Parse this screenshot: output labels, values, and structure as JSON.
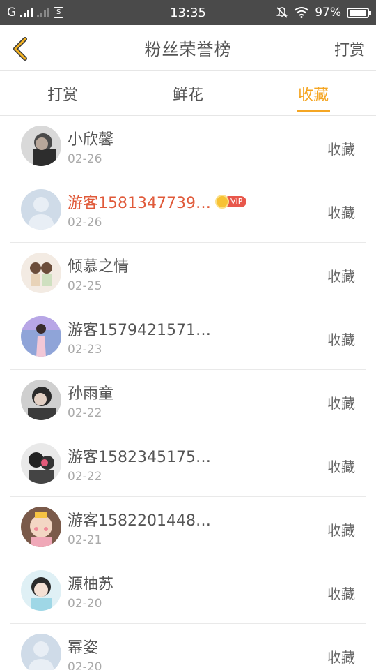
{
  "status_bar": {
    "carrier": "G",
    "sim_label": "S",
    "time": "13:35",
    "battery": "97%"
  },
  "header": {
    "title": "粉丝荣誉榜",
    "action_label": "打赏"
  },
  "tabs": [
    {
      "label": "打赏"
    },
    {
      "label": "鲜花"
    },
    {
      "label": "收藏"
    }
  ],
  "active_tab": "收藏",
  "accent_color": "#f5a623",
  "vip_badge_text": "VIP",
  "list": [
    {
      "name": "小欣馨",
      "date": "02-26",
      "action": "收藏",
      "vip": false
    },
    {
      "name": "游客1581347739…",
      "date": "02-26",
      "action": "收藏",
      "vip": true
    },
    {
      "name": "倾慕之情",
      "date": "02-25",
      "action": "收藏",
      "vip": false
    },
    {
      "name": "游客1579421571…",
      "date": "02-23",
      "action": "收藏",
      "vip": false
    },
    {
      "name": "孙雨童",
      "date": "02-22",
      "action": "收藏",
      "vip": false
    },
    {
      "name": "游客1582345175…",
      "date": "02-22",
      "action": "收藏",
      "vip": false
    },
    {
      "name": "游客1582201448…",
      "date": "02-21",
      "action": "收藏",
      "vip": false
    },
    {
      "name": "源柚苏",
      "date": "02-20",
      "action": "收藏",
      "vip": false
    },
    {
      "name": "幂姿",
      "date": "02-20",
      "action": "收藏",
      "vip": false
    }
  ]
}
